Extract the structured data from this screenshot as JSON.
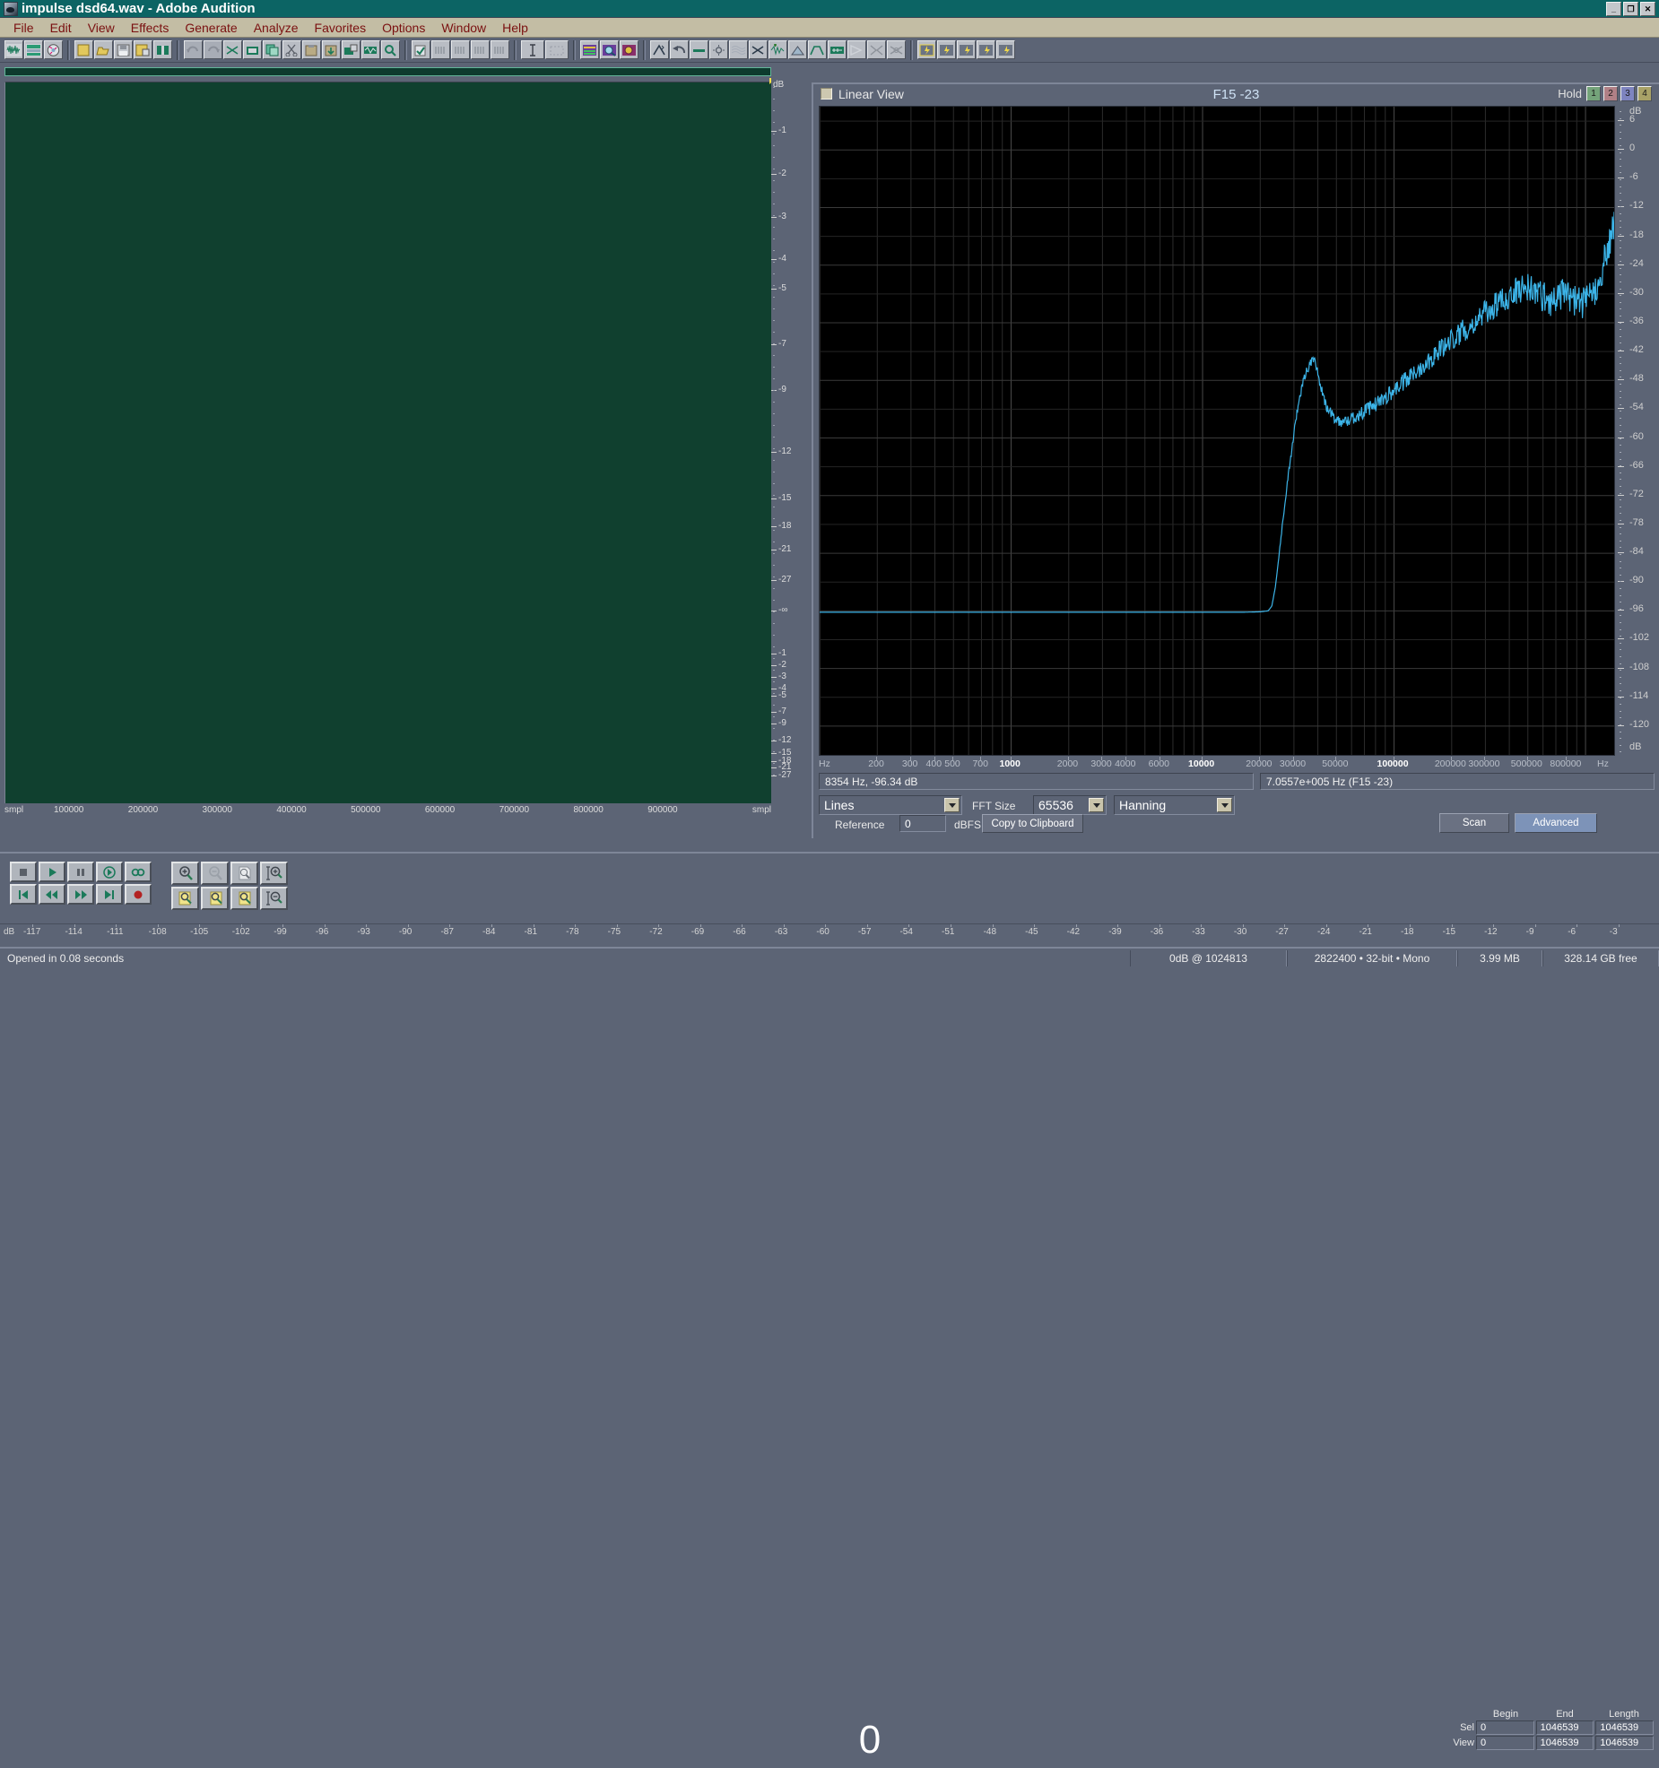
{
  "window": {
    "title": "impulse dsd64.wav - Adobe Audition",
    "app_icon": "audition-icon",
    "minimize": "_",
    "maximize": "❐",
    "close": "✕"
  },
  "menu": [
    {
      "label": "File"
    },
    {
      "label": "Edit"
    },
    {
      "label": "View"
    },
    {
      "label": "Effects"
    },
    {
      "label": "Generate"
    },
    {
      "label": "Analyze"
    },
    {
      "label": "Favorites"
    },
    {
      "label": "Options"
    },
    {
      "label": "Window"
    },
    {
      "label": "Help"
    }
  ],
  "toolbar": {
    "groups": [
      {
        "name": "view-modes",
        "icons": [
          "waveform-view-icon",
          "multitrack-view-icon",
          "cd-view-icon"
        ]
      },
      {
        "name": "file-ops",
        "icons": [
          "new-file-icon",
          "open-file-icon",
          "save-icon",
          "save-as-icon",
          "close-file-icon"
        ]
      },
      {
        "name": "edit-ops",
        "icons": [
          "undo-icon",
          "redo-icon",
          "cut-marquee-icon",
          "trim-icon",
          "copy-icon",
          "scissors-icon",
          "paste-icon",
          "mix-paste-icon",
          "paste-to-new-icon",
          "noise-reduction-icon",
          "search-icon"
        ]
      },
      {
        "name": "markers",
        "icons": [
          "zero-cross-icon",
          "snap-icon",
          "marker-list-1-icon",
          "marker-list-2-icon",
          "marker-list-3-icon"
        ]
      },
      {
        "name": "tools",
        "icons": [
          "time-select-icon",
          "marquee-select-icon"
        ]
      },
      {
        "name": "displays",
        "icons": [
          "spectral-display-icon",
          "zoom-spectral-icon",
          "pan-spectral-icon"
        ]
      },
      {
        "name": "effects",
        "icons": [
          "amplify-icon",
          "undo-effect-icon",
          "normalize-icon",
          "dynamics-icon",
          "fft-filter-icon",
          "noise-gate-icon",
          "delay-icon",
          "reverb-icon",
          "envelope-icon",
          "pitch-icon",
          "flange-icon",
          "stereo-field-icon",
          "channel-mixer-icon"
        ]
      },
      {
        "name": "favorites",
        "icons": [
          "fav-1-icon",
          "fav-2-icon",
          "fav-3-icon",
          "fav-4-icon",
          "fav-5-icon"
        ]
      }
    ]
  },
  "waveform": {
    "db_ruler_label": "dB",
    "db_ticks": [
      "-1",
      "-2",
      "-3",
      "-4",
      "-5",
      "-7",
      "-9",
      "-12",
      "-15",
      "-18",
      "-21",
      "-27",
      "-∞",
      "-27",
      "-21",
      "-18",
      "-15",
      "-12",
      "-9",
      "-7",
      "-5",
      "-4",
      "-3",
      "-2",
      "-1"
    ],
    "x_unit_left": "smpl",
    "x_unit_right": "smpl",
    "x_ticks": [
      "100000",
      "200000",
      "300000",
      "400000",
      "500000",
      "600000",
      "700000",
      "800000",
      "900000"
    ]
  },
  "spectrum": {
    "linear_view_label": "Linear View",
    "linear_view_checked": false,
    "title": "F15 -23",
    "hold_label": "Hold",
    "hold_buttons": [
      "1",
      "2",
      "3",
      "4"
    ],
    "hold_colors": [
      "#74a37a",
      "#b08086",
      "#7e84c0",
      "#a8a267"
    ],
    "readout_left": "8354 Hz, -96.34 dB",
    "readout_right": "7.0557e+005 Hz (F15 -23)",
    "display_mode": "Lines",
    "fft_size_label": "FFT Size",
    "fft_size": "65536",
    "window_function": "Hanning",
    "reference_label": "Reference",
    "reference_value": "0",
    "reference_unit": "dBFS",
    "copy_button": "Copy to Clipboard",
    "scan_button": "Scan",
    "advanced_button": "Advanced",
    "trace_color": "#3cb4e8"
  },
  "chart_data": {
    "type": "line",
    "title": "F15 -23",
    "xlabel": "Hz",
    "ylabel": "dB",
    "xscale": "log",
    "xlim": [
      100,
      1411200
    ],
    "ylim": [
      -126,
      9
    ],
    "grid": true,
    "legend": false,
    "x_unit_label": "Hz",
    "y_unit_label": "dB",
    "y_ticks": [
      6,
      0,
      -6,
      -12,
      -18,
      -24,
      -30,
      -36,
      -42,
      -48,
      -54,
      -60,
      -66,
      -72,
      -78,
      -84,
      -90,
      -96,
      -102,
      -108,
      -114,
      -120
    ],
    "x_ticks": [
      200,
      300,
      400,
      500,
      700,
      1000,
      2000,
      3000,
      4000,
      6000,
      10000,
      20000,
      30000,
      50000,
      100000,
      200000,
      300000,
      500000,
      800000
    ],
    "x_tick_labels": [
      "200",
      "300",
      "400",
      "500",
      "700",
      "1000",
      "2000",
      "3000",
      "4000",
      "6000",
      "10000",
      "20000",
      "30000",
      "50000",
      "100000",
      "200000",
      "300000",
      "500000",
      "800000"
    ],
    "x_major_labels": [
      "1000",
      "10000",
      "100000"
    ],
    "series": [
      {
        "name": "F15 -23 spectrum",
        "color": "#3cb4e8",
        "points": [
          [
            100,
            -96.3
          ],
          [
            200,
            -96.3
          ],
          [
            400,
            -96.3
          ],
          [
            800,
            -96.3
          ],
          [
            1500,
            -96.3
          ],
          [
            3000,
            -96.3
          ],
          [
            6000,
            -96.3
          ],
          [
            10000,
            -96.3
          ],
          [
            16000,
            -96.3
          ],
          [
            20000,
            -96.2
          ],
          [
            22000,
            -96.0
          ],
          [
            23000,
            -95.0
          ],
          [
            24000,
            -91.0
          ],
          [
            25000,
            -85.0
          ],
          [
            26000,
            -79.0
          ],
          [
            27000,
            -73.0
          ],
          [
            28000,
            -68.0
          ],
          [
            29000,
            -63.5
          ],
          [
            30000,
            -59.0
          ],
          [
            31000,
            -55.0
          ],
          [
            32000,
            -52.0
          ],
          [
            33000,
            -49.5
          ],
          [
            34000,
            -47.5
          ],
          [
            35000,
            -46.0
          ],
          [
            36000,
            -45.0
          ],
          [
            37000,
            -44.0
          ],
          [
            38000,
            -43.5
          ],
          [
            39000,
            -44.5
          ],
          [
            40000,
            -46.0
          ],
          [
            41000,
            -48.5
          ],
          [
            43000,
            -52.0
          ],
          [
            45000,
            -54.0
          ],
          [
            48000,
            -55.5
          ],
          [
            52000,
            -56.5
          ],
          [
            57000,
            -56.5
          ],
          [
            63000,
            -55.5
          ],
          [
            70000,
            -54.5
          ],
          [
            80000,
            -53.0
          ],
          [
            90000,
            -51.5
          ],
          [
            100000,
            -50.0
          ],
          [
            120000,
            -47.5
          ],
          [
            140000,
            -45.0
          ],
          [
            170000,
            -42.0
          ],
          [
            200000,
            -39.5
          ],
          [
            250000,
            -36.5
          ],
          [
            300000,
            -34.0
          ],
          [
            350000,
            -32.0
          ],
          [
            400000,
            -30.5
          ],
          [
            450000,
            -29.0
          ],
          [
            500000,
            -28.5
          ],
          [
            550000,
            -29.5
          ],
          [
            600000,
            -30.5
          ],
          [
            650000,
            -31.5
          ],
          [
            700000,
            -31.0
          ],
          [
            750000,
            -30.0
          ],
          [
            800000,
            -30.5
          ],
          [
            900000,
            -31.5
          ],
          [
            1000000,
            -32.0
          ],
          [
            1100000,
            -30.0
          ],
          [
            1200000,
            -26.0
          ],
          [
            1300000,
            -21.0
          ],
          [
            1411200,
            -16.0
          ]
        ],
        "noise_band_db": 3.0,
        "noise_start_hz": 25000,
        "floor_db": -96.3
      }
    ]
  },
  "transport": {
    "buttons_row1": [
      "stop-button",
      "play-button",
      "pause-button",
      "play-to-end-button",
      "loop-button"
    ],
    "buttons_row2": [
      "go-to-beginning-button",
      "rewind-button",
      "fast-forward-button",
      "go-to-end-button",
      "record-button"
    ],
    "zoom_row1": [
      "zoom-in-horizontal-icon",
      "zoom-out-horizontal-icon",
      "zoom-full-icon",
      "zoom-in-vertical-icon"
    ],
    "zoom_row2": [
      "zoom-to-selection-left-icon",
      "zoom-to-selection-right-icon",
      "zoom-to-selection-icon",
      "zoom-out-vertical-icon"
    ],
    "time_display": "0"
  },
  "selection": {
    "headers": [
      "Begin",
      "End",
      "Length"
    ],
    "rows": [
      {
        "tag": "Sel",
        "begin": "0",
        "end": "1046539",
        "length": "1046539"
      },
      {
        "tag": "View",
        "begin": "0",
        "end": "1046539",
        "length": "1046539"
      }
    ]
  },
  "level_meter": {
    "ticks": [
      "-117",
      "-114",
      "-111",
      "-108",
      "-105",
      "-102",
      "-99",
      "-96",
      "-93",
      "-90",
      "-87",
      "-84",
      "-81",
      "-78",
      "-75",
      "-72",
      "-69",
      "-66",
      "-63",
      "-60",
      "-57",
      "-54",
      "-51",
      "-48",
      "-45",
      "-42",
      "-39",
      "-36",
      "-33",
      "-30",
      "-27",
      "-24",
      "-21",
      "-18",
      "-15",
      "-12",
      "-9",
      "-6",
      "-3"
    ],
    "left_label": "dB"
  },
  "statusbar": {
    "message": "Opened in 0.08 seconds",
    "cells": [
      "0dB @ 1024813",
      "2822400 • 32-bit • Mono",
      "3.99 MB",
      "328.14 GB free"
    ]
  }
}
